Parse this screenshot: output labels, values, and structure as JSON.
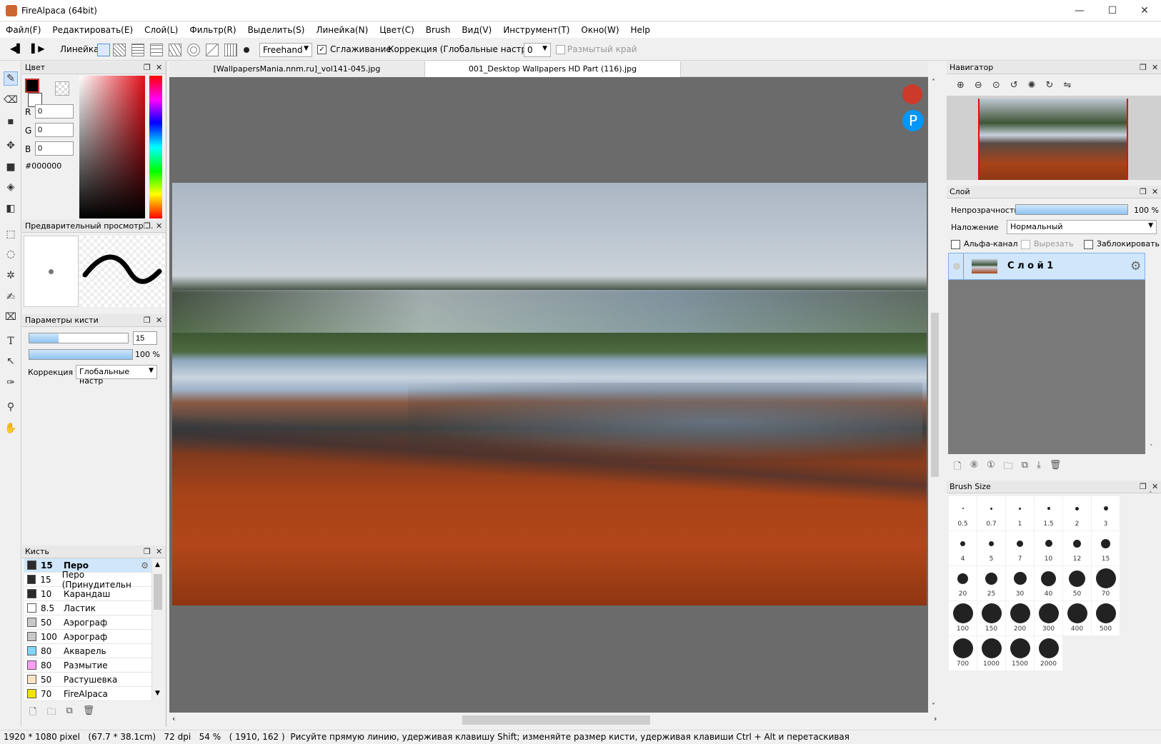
{
  "window": {
    "title": "FireAlpaca (64bit)",
    "minimize": "—",
    "maximize": "☐",
    "close": "✕"
  },
  "menu": [
    "Файл(F)",
    "Редактировать(E)",
    "Слой(L)",
    "Фильтр(R)",
    "Выделить(S)",
    "Линейка(N)",
    "Цвет(C)",
    "Brush",
    "Вид(V)",
    "Инструмент(T)",
    "Окно(W)",
    "Help"
  ],
  "toolbar": {
    "ruler_label": "Линейка",
    "mode_value": "Freehand",
    "smoothing_label": "Сглаживание",
    "correction_label": "Коррекция (Глобальные настройки)",
    "correction_value": "0",
    "blur_edge_label": "Размытый край"
  },
  "tabs": [
    "[WallpapersMania.nnm.ru]_vol141-045.jpg",
    "001_Desktop Wallpapers  HD Part (116).jpg"
  ],
  "color_panel": {
    "title": "Цвет",
    "r_label": "R",
    "r_value": "0",
    "g_label": "G",
    "g_value": "0",
    "b_label": "B",
    "b_value": "0",
    "hex": "#000000",
    "fg_color": "#000000"
  },
  "preview_panel": {
    "title": "Предварительный просмотр ..."
  },
  "brush_params": {
    "title": "Параметры кисти",
    "size_value": "15",
    "opacity_value": "100 %",
    "correction_label": "Коррекция",
    "correction_value": "Глобальные настр"
  },
  "brush_panel": {
    "title": "Кисть",
    "items": [
      {
        "size": "15",
        "name": "Перо",
        "color": "#2b2b2b"
      },
      {
        "size": "15",
        "name": "Перо (Принудительн",
        "color": "#2b2b2b"
      },
      {
        "size": "10",
        "name": "Карандаш",
        "color": "#2b2b2b"
      },
      {
        "size": "8.5",
        "name": "Ластик",
        "color": "#ffffff"
      },
      {
        "size": "50",
        "name": "Аэрограф",
        "color": "#c8c8c8"
      },
      {
        "size": "100",
        "name": "Аэрограф",
        "color": "#c8c8c8"
      },
      {
        "size": "80",
        "name": "Акварель",
        "color": "#7fd7ff"
      },
      {
        "size": "80",
        "name": "Размытие",
        "color": "#ff9cf5"
      },
      {
        "size": "50",
        "name": "Растушевка",
        "color": "#ffe1c4"
      },
      {
        "size": "70",
        "name": "FireAlpaca",
        "color": "#f5e400"
      }
    ]
  },
  "navigator": {
    "title": "Навигатор"
  },
  "layer_panel": {
    "title": "Слой",
    "opacity_label": "Непрозрачность",
    "opacity_value": "100 %",
    "blend_label": "Наложение",
    "blend_value": "Нормальный",
    "alpha_label": "Альфа-канал",
    "clip_label": "Вырезать",
    "lock_label": "Заблокировать",
    "layer_name": "С л о й 1"
  },
  "brush_size_panel": {
    "title": "Brush Size",
    "sizes": [
      "0.5",
      "0.7",
      "1",
      "1.5",
      "2",
      "3",
      "4",
      "5",
      "7",
      "10",
      "12",
      "15",
      "20",
      "25",
      "30",
      "40",
      "50",
      "70",
      "100",
      "150",
      "200",
      "300",
      "400",
      "500",
      "700",
      "1000",
      "1500",
      "2000"
    ]
  },
  "status": {
    "dims": "1920 * 1080 pixel",
    "cm": "(67.7 * 38.1cm)",
    "dpi": "72 dpi",
    "zoom": "54 %",
    "coords": "( 1910, 162 )",
    "hint": "Рисуйте прямую линию, удерживая клавишу Shift; изменяйте размер кисти, удерживая клавиши Ctrl + Alt и перетаскивая"
  }
}
